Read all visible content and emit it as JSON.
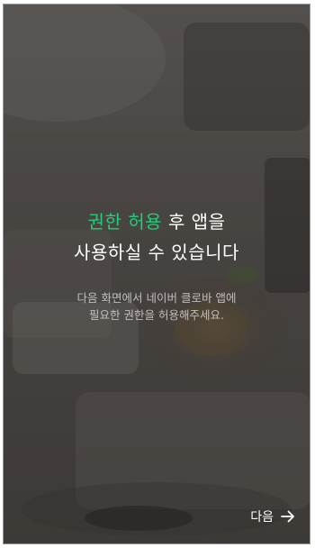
{
  "onboarding": {
    "headline": {
      "accent": "권한 허용",
      "rest_line1": " 후 앱을",
      "line2": "사용하실 수 있습니다"
    },
    "subtitle": {
      "line1": "다음 화면에서 네이버 클로바 앱에",
      "line2": "필요한 권한을 허용해주세요."
    },
    "next_label": "다음",
    "next_icon": "arrow-right-icon",
    "accent_color": "#1fd07a"
  }
}
